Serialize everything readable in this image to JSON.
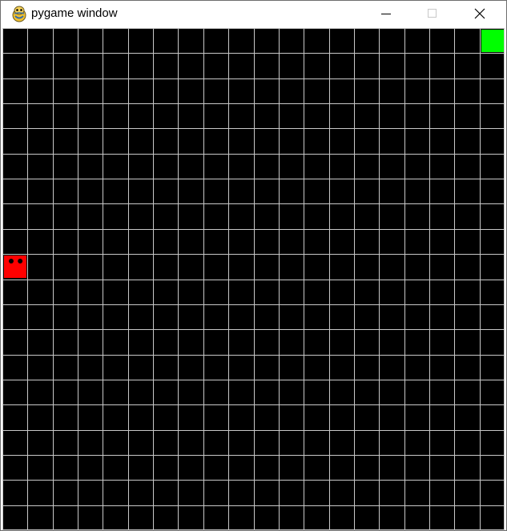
{
  "window": {
    "title": "pygame window",
    "controls": {
      "minimize_icon": "minimize-icon",
      "maximize_icon": "maximize-icon",
      "close_icon": "close-icon"
    }
  },
  "game": {
    "grid": {
      "columns": 20,
      "rows": 20,
      "background_color": "#000000",
      "line_color": "#c8c8c8"
    },
    "snake": {
      "color": "#ff0000",
      "eye_color": "#000000",
      "segments": [
        {
          "col": 0,
          "row": 9
        }
      ]
    },
    "food": {
      "color": "#00ff00",
      "col": 19,
      "row": 0
    }
  }
}
